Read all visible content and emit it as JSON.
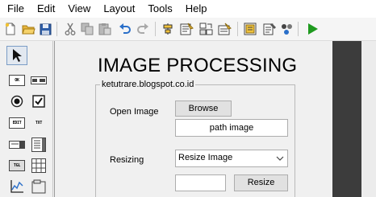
{
  "menu": [
    "File",
    "Edit",
    "View",
    "Layout",
    "Tools",
    "Help"
  ],
  "toolbar": {
    "buttons": [
      "new-file",
      "open-folder",
      "save",
      "cut",
      "copy",
      "paste",
      "undo",
      "redo",
      "align",
      "menu-editor",
      "tab-order",
      "toolbar-editor",
      "m-file-editor",
      "property-inspector",
      "object-browser",
      "run"
    ]
  },
  "palette": {
    "items": [
      "select",
      "push-button",
      "slider",
      "radio-button",
      "checkbox",
      "edit-text",
      "static-text",
      "popup-menu",
      "listbox",
      "toggle-button",
      "table",
      "axes",
      "panel"
    ],
    "labels": {
      "push": "OK",
      "edit": "EDIT",
      "static": "TXT",
      "toggle": "TGL"
    }
  },
  "figure": {
    "title": "IMAGE PROCESSING",
    "panel_title": "ketutrare.blogspot.co.id",
    "open_image_label": "Open Image",
    "browse_label": "Browse",
    "path_value": "path image",
    "resizing_label": "Resizing",
    "resize_select_value": "Resize Image",
    "resize_input_value": "",
    "resize_button_label": "Resize"
  },
  "colors": {
    "run_green": "#1f9a1f",
    "undo_blue": "#2a6fc9",
    "folder_yellow": "#e7b53c"
  }
}
